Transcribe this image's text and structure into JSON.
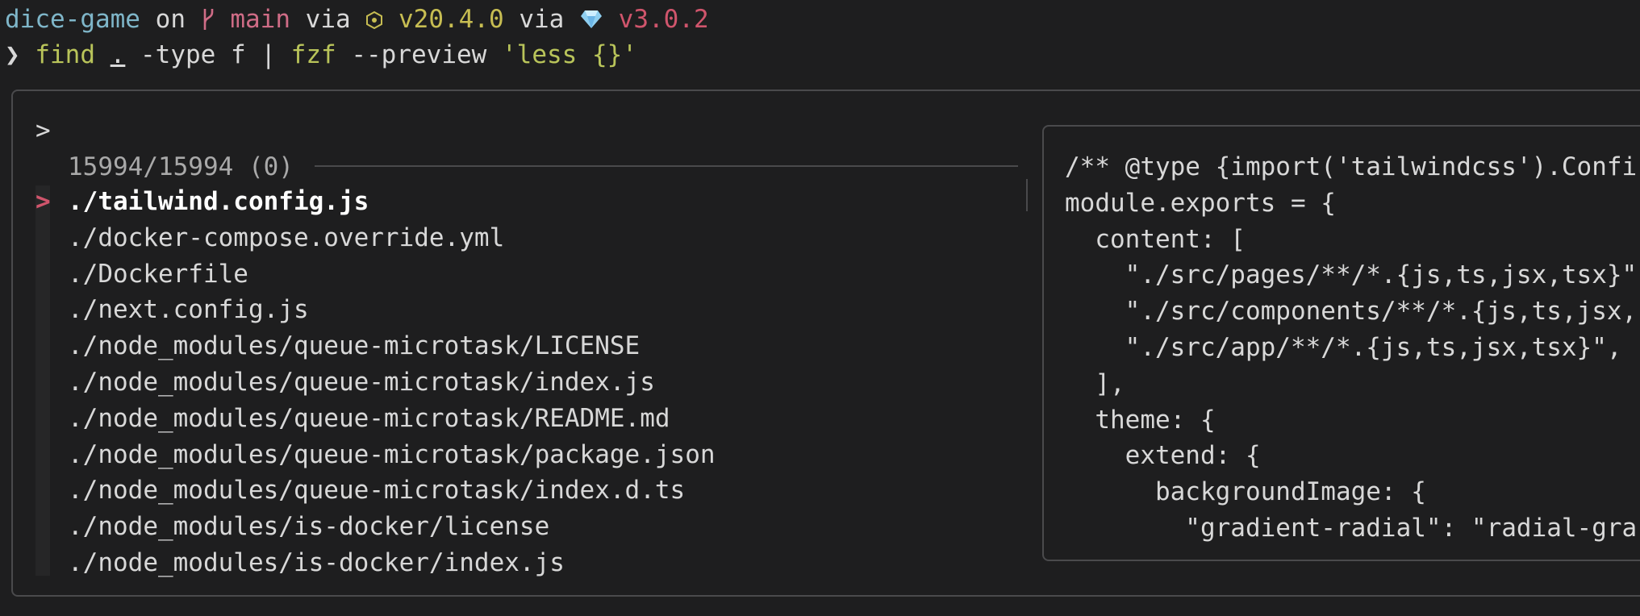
{
  "shell": {
    "dir": "dice-game",
    "on": "on",
    "branch_icon": "branch-icon",
    "branch": "main",
    "via1": "via",
    "node_icon": "node-icon",
    "node_version": "v20.4.0",
    "via2": "via",
    "ruby_icon": "ruby-icon",
    "ruby_version": "v3.0.2",
    "command_arrow": "❯",
    "command_parts": {
      "cmd": "find",
      "dot": ".",
      "args1": "-type f |",
      "cmd2": "fzf",
      "args2": "--preview",
      "str": "'less {}'"
    }
  },
  "fzf": {
    "query_prompt": ">",
    "counter": "15994/15994 (0)",
    "pointer": ">",
    "results": [
      "./tailwind.config.js",
      "./docker-compose.override.yml",
      "./Dockerfile",
      "./next.config.js",
      "./node_modules/queue-microtask/LICENSE",
      "./node_modules/queue-microtask/index.js",
      "./node_modules/queue-microtask/README.md",
      "./node_modules/queue-microtask/package.json",
      "./node_modules/queue-microtask/index.d.ts",
      "./node_modules/is-docker/license",
      "./node_modules/is-docker/index.js"
    ],
    "preview_lines": [
      "/** @type {import('tailwindcss').Confi",
      "module.exports = {",
      "  content: [",
      "    \"./src/pages/**/*.{js,ts,jsx,tsx}\"",
      "    \"./src/components/**/*.{js,ts,jsx,",
      "    \"./src/app/**/*.{js,ts,jsx,tsx}\",",
      "  ],",
      "  theme: {",
      "    extend: {",
      "      backgroundImage: {",
      "        \"gradient-radial\": \"radial-gra"
    ]
  },
  "colors": {
    "background": "#1e1e1f",
    "border": "#4a4a4c",
    "accent_red": "#d0556c",
    "green": "#b9c45a",
    "cyan": "#7fb6c9"
  }
}
